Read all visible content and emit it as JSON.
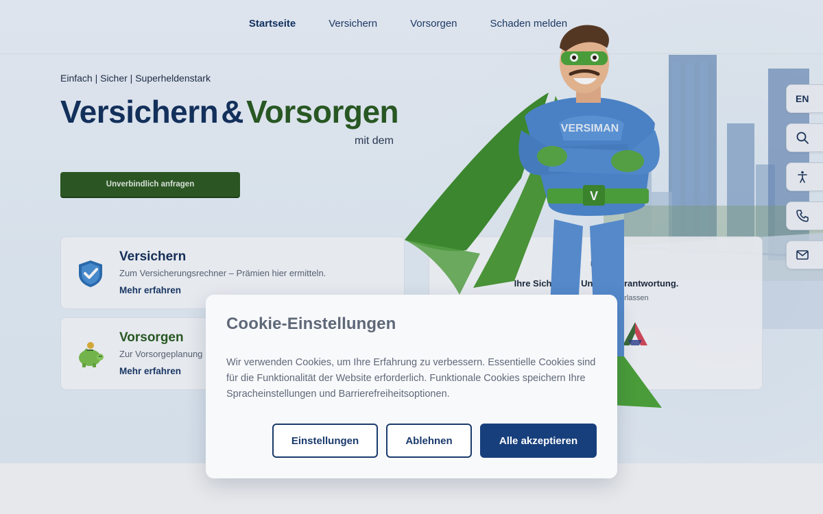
{
  "nav": {
    "items": [
      {
        "label": "Startseite",
        "active": true
      },
      {
        "label": "Versichern",
        "active": false
      },
      {
        "label": "Vorsorgen",
        "active": false
      },
      {
        "label": "Schaden melden",
        "active": false
      }
    ]
  },
  "hero": {
    "tagline": "Einfach | Sicher | Superheldenstark",
    "headline_part1": "Versichern",
    "headline_amp": "&",
    "headline_part2": "Vorsorgen",
    "subheadline": "mit dem",
    "cta_label": "Unverbindlich anfragen",
    "mascot_chest_text": "VERSIMAN",
    "mascot_belt_text": "V",
    "colors": {
      "navy": "#14325e",
      "green": "#2b5c22"
    }
  },
  "cards": {
    "versichern": {
      "title": "Versichern",
      "description": "Zum Versicherungsrechner – Prämien hier ermitteln.",
      "link": "Mehr erfahren",
      "icon": "shield-check-icon"
    },
    "vorsorgen": {
      "title": "Vorsorgen",
      "description": "Zur Vorsorgeplanung",
      "link": "Mehr erfahren",
      "icon": "piggy-bank-icon"
    },
    "security": {
      "title": "Ihre Sicherheit. Unsere Verantwortung.",
      "description": "...en, auf die Sie sich verlassen",
      "icon": "lock-icon"
    }
  },
  "side_toolbar": {
    "language": "EN",
    "icons": [
      "search-icon",
      "accessibility-icon",
      "phone-icon",
      "mail-icon"
    ]
  },
  "cookie_dialog": {
    "title": "Cookie-Einstellungen",
    "body": "Wir verwenden Cookies, um Ihre Erfahrung zu verbessern. Essentielle Cookies sind für die Funktionalität der Website erforderlich. Funktionale Cookies speichern Ihre Spracheinstellungen und Barrierefreiheitsoptionen.",
    "settings_label": "Einstellungen",
    "decline_label": "Ablehnen",
    "accept_label": "Alle akzeptieren",
    "colors": {
      "primary": "#173f7c"
    }
  }
}
